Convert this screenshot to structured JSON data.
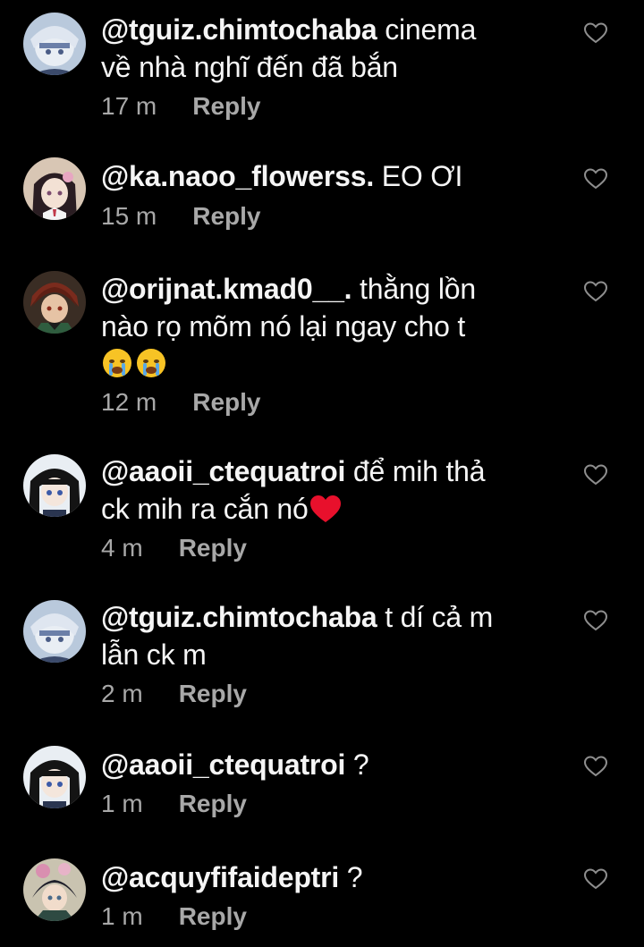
{
  "comments": [
    {
      "user": "@tguiz.chimtochaba",
      "text_line1": " cinema",
      "text_line2": "về nhà nghĩ đến đã bắn",
      "time": "17 m",
      "reply": "Reply",
      "avatar": "white-hair-anime-avatar"
    },
    {
      "user": "@ka.naoo_flowerss.",
      "text_line1": " EO ƠI",
      "time": "15 m",
      "reply": "Reply",
      "avatar": "dark-hair-anime-girl-avatar"
    },
    {
      "user": "@orijnat.kmad0__.",
      "text_line1": " thằng lồn",
      "text_line2": "nào rọ mõm nó lại ngay cho t",
      "emoji": "crying-face-emoji",
      "time": "12 m",
      "reply": "Reply",
      "avatar": "red-hair-anime-boy-avatar"
    },
    {
      "user": "@aaoii_ctequatroi",
      "text_line1": " để mih thả",
      "text_line2": "ck mih ra cắn nó",
      "emoji": "red-heart-emoji",
      "time": "4 m",
      "reply": "Reply",
      "avatar": "black-hair-anime-girl-avatar"
    },
    {
      "user": "@tguiz.chimtochaba",
      "text_line1": " t dí cả m",
      "text_line2": "lẫn ck m",
      "time": "2 m",
      "reply": "Reply",
      "avatar": "white-hair-anime-avatar"
    },
    {
      "user": "@aaoii_ctequatroi",
      "text_line1": " ?",
      "time": "1 m",
      "reply": "Reply",
      "avatar": "black-hair-anime-girl-avatar"
    },
    {
      "user": "@acquyfifaideptri",
      "text_line1": " ?",
      "time": "1 m",
      "reply": "Reply",
      "avatar": "anime-character-avatar"
    }
  ],
  "colors": {
    "background": "#000000",
    "text": "#f5f5f5",
    "meta": "#a8a8a8",
    "heart_outline": "#8e8e8e"
  },
  "icons": {
    "like": "heart-outline-icon"
  }
}
